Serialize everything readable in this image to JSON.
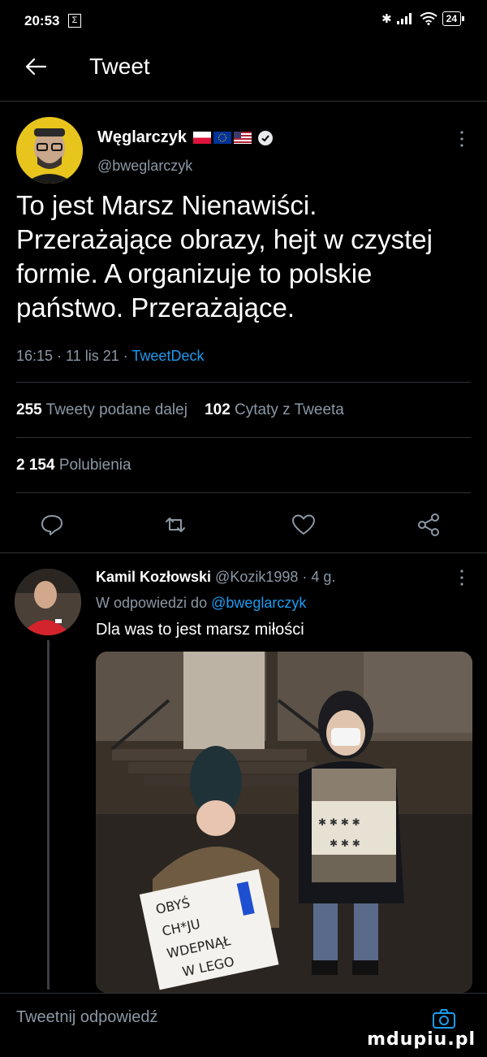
{
  "status_bar": {
    "time": "20:53",
    "battery": "24"
  },
  "header": {
    "title": "Tweet"
  },
  "tweet": {
    "author_name": "Węglarczyk",
    "handle": "@bweglarczyk",
    "text": "To jest Marsz Nienawiści. Przerażające obrazy, hejt w czystej formie. A organizuje to polskie państwo. Przerażające.",
    "time_date": "16:15 · 11 lis 21 · ",
    "source": "TweetDeck",
    "retweets_count": "255",
    "retweets_label": "Tweety podane dalej",
    "quotes_count": "102",
    "quotes_label": "Cytaty z Tweeta",
    "likes_count": "2 154",
    "likes_label": "Polubienia"
  },
  "reply": {
    "author_name": "Kamil Kozłowski",
    "handle_time": "@Kozik1998 · 4 g.",
    "reply_prefix": "W odpowiedzi do ",
    "mention": "@bweglarczyk",
    "text": "Dla was to jest marsz miłości",
    "sign_left": [
      "OBYŚ",
      "CH*JU",
      "WDEPNĄŁ",
      "W LEGO"
    ]
  },
  "compose": {
    "placeholder": "Tweetnij odpowiedź"
  },
  "watermark": "mdupiu.pl",
  "colors": {
    "accent": "#1d9bf0",
    "muted": "#8b98a5",
    "background": "#000000"
  }
}
